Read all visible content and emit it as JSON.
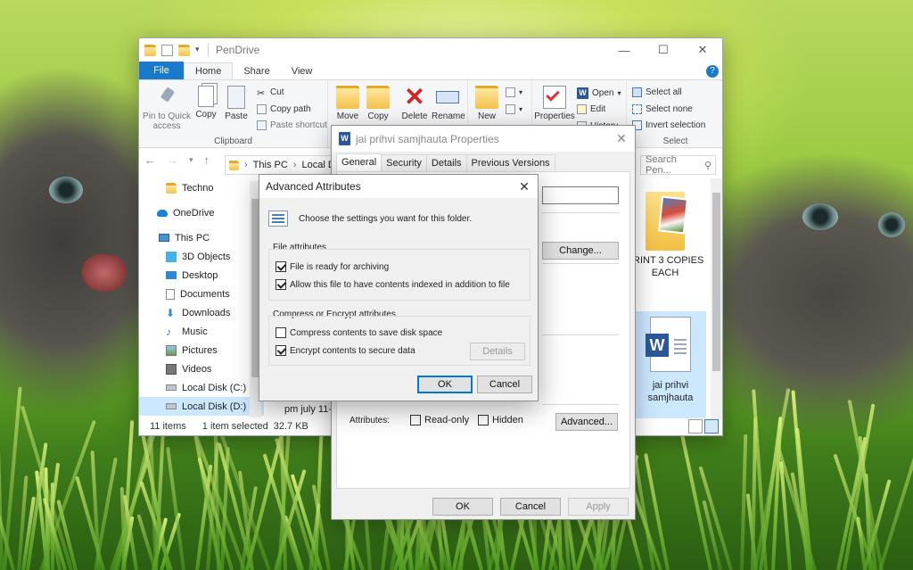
{
  "explorer": {
    "title": "PenDrive",
    "ribbon_tabs": [
      "File",
      "Home",
      "Share",
      "View"
    ],
    "ribbon": {
      "clipboard": {
        "pin_label": "Pin to Quick",
        "pin_label2": "access",
        "copy": "Copy",
        "paste": "Paste",
        "cut": "Cut",
        "copy_path": "Copy path",
        "paste_shortcut": "Paste shortcut",
        "group": "Clipboard"
      },
      "organize": {
        "move": "Move",
        "copy": "Copy",
        "delete": "Delete",
        "rename": "Rename"
      },
      "new": {
        "new": "New"
      },
      "open": {
        "properties": "Properties",
        "open": "Open",
        "edit": "Edit",
        "history": "History"
      },
      "select": {
        "select_all": "Select all",
        "select_none": "Select none",
        "invert": "Invert selection",
        "group": "Select"
      }
    },
    "address": {
      "this_pc": "This PC",
      "local": "Local D",
      "search_placeholder": "Search Pen..."
    },
    "nav": [
      {
        "label": "Techno"
      },
      {
        "label": "OneDrive"
      },
      {
        "label": "This PC"
      },
      {
        "label": "3D Objects"
      },
      {
        "label": "Desktop"
      },
      {
        "label": "Documents"
      },
      {
        "label": "Downloads"
      },
      {
        "label": "Music"
      },
      {
        "label": "Pictures"
      },
      {
        "label": "Videos"
      },
      {
        "label": "Local Disk (C:)"
      },
      {
        "label": "Local Disk (D:)"
      }
    ],
    "files": {
      "print_line1": "PRINT 3 COPIES",
      "print_line2": "EACH",
      "doc_line1": "jai prihvi",
      "doc_line2": "samjhauta",
      "partial": "pm july 11-"
    },
    "status": {
      "count": "11 items",
      "selected": "1 item selected",
      "size": "32.7 KB"
    }
  },
  "properties": {
    "title": "jai prihvi samjhauta Properties",
    "tabs": [
      "General",
      "Security",
      "Details",
      "Previous Versions"
    ],
    "change_button": "Change...",
    "attributes_label": "Attributes:",
    "readonly": "Read-only",
    "hidden": "Hidden",
    "advanced_button": "Advanced...",
    "ok": "OK",
    "cancel": "Cancel",
    "apply": "Apply"
  },
  "advanced": {
    "title": "Advanced Attributes",
    "intro": "Choose the settings you want for this folder.",
    "file_attr_group": "File attributes",
    "archive": "File is ready for archiving",
    "index": "Allow this file to have contents indexed in addition to file",
    "compress_group": "Compress or Encrypt attributes",
    "compress": "Compress contents to save disk space",
    "encrypt": "Encrypt contents to secure data",
    "details": "Details",
    "ok": "OK",
    "cancel": "Cancel"
  },
  "colors": {
    "accent": "#1979ca",
    "selection": "#cce8ff",
    "word": "#2b579a"
  }
}
